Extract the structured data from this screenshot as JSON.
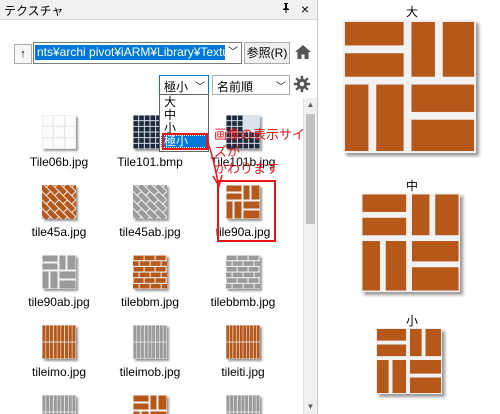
{
  "panel": {
    "title": "テクスチャ",
    "pin_glyph": "ꟸ",
    "close_glyph": "×",
    "path": "nts¥archi pivot¥iARM¥Library¥Texture",
    "browse_label": "参照(R)",
    "size_value": "極小",
    "sort_value": "名前順",
    "size_options": [
      "大",
      "中",
      "小",
      "極小"
    ],
    "selected_size_index": 3,
    "callout": [
      "画像の表示サイズが",
      "かわります"
    ]
  },
  "grid": [
    {
      "name": "Tile06b.jpg",
      "pattern": "white-tile"
    },
    {
      "name": "Tile101.bmp",
      "pattern": "dark-grid"
    },
    {
      "name": "Tile101b.jpg",
      "pattern": "dark-grid-partial"
    },
    {
      "name": "tile45a.jpg",
      "pattern": "herringbone-brown"
    },
    {
      "name": "tile45ab.jpg",
      "pattern": "herringbone-gray"
    },
    {
      "name": "tile90a.jpg",
      "pattern": "basket-brown"
    },
    {
      "name": "tile90ab.jpg",
      "pattern": "basket-gray"
    },
    {
      "name": "tilebbm.jpg",
      "pattern": "brick-brown"
    },
    {
      "name": "tilebbmb.jpg",
      "pattern": "brick-gray"
    },
    {
      "name": "tileimo.jpg",
      "pattern": "stack-brown"
    },
    {
      "name": "tileimob.jpg",
      "pattern": "stack-gray"
    },
    {
      "name": "tileiti.jpg",
      "pattern": "fine-brown"
    }
  ],
  "samples": {
    "large_label": "大",
    "medium_label": "中",
    "small_label": "小"
  },
  "colors": {
    "accent": "#0078d7",
    "callout": "#e8151b",
    "tile_brown": "#b5581a",
    "grout": "#f2f2f2",
    "tile_gray": "#9b9b9b"
  }
}
